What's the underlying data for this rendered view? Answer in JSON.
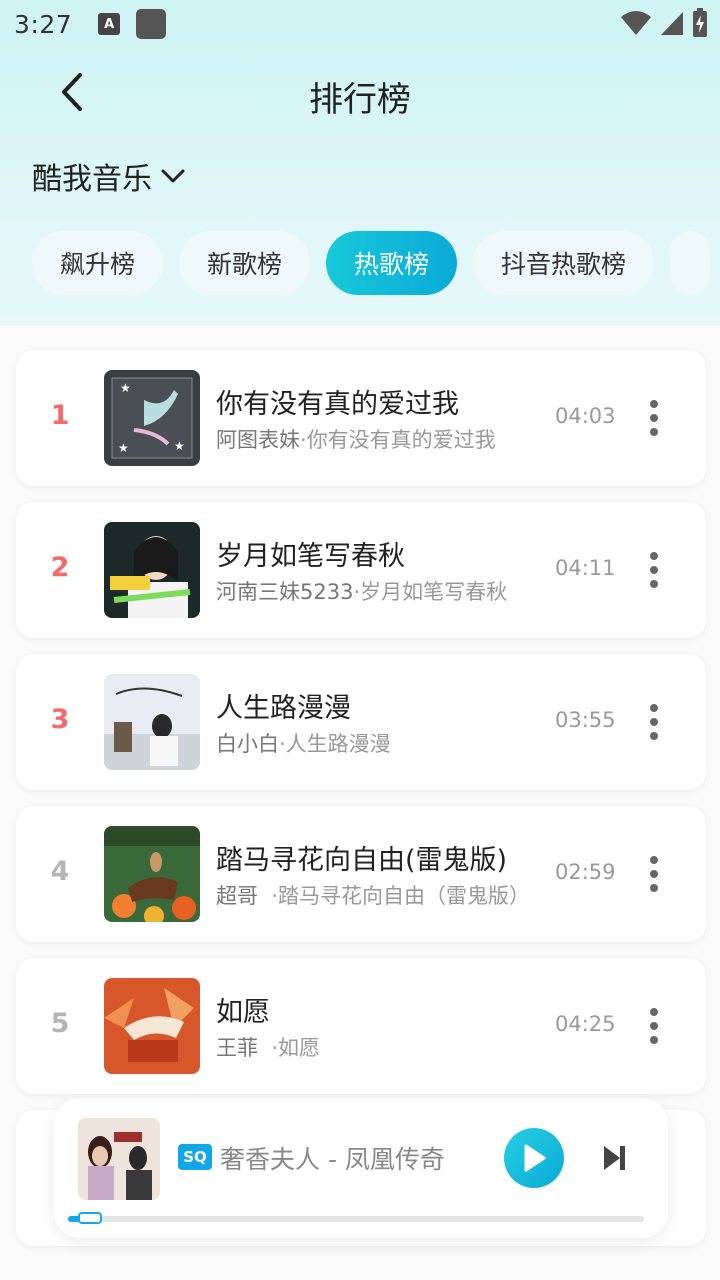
{
  "status": {
    "time": "3:27",
    "notif_icon_letter": "A"
  },
  "nav": {
    "title": "排行榜"
  },
  "source": {
    "label": "酷我音乐"
  },
  "tabs": [
    {
      "label": "飙升榜",
      "active": false
    },
    {
      "label": "新歌榜",
      "active": false
    },
    {
      "label": "热歌榜",
      "active": true
    },
    {
      "label": "抖音热歌榜",
      "active": false
    }
  ],
  "songs": [
    {
      "rank": "1",
      "title": "你有没有真的爱过我",
      "artist": "阿图表妹",
      "album": "你有没有真的爱过我",
      "duration": "04:03"
    },
    {
      "rank": "2",
      "title": "岁月如笔写春秋",
      "artist": "河南三妹5233",
      "album": "岁月如笔写春秋",
      "duration": "04:11"
    },
    {
      "rank": "3",
      "title": "人生路漫漫",
      "artist": "白小白",
      "album": "人生路漫漫",
      "duration": "03:55"
    },
    {
      "rank": "4",
      "title": "踏马寻花向自由(雷鬼版)",
      "artist": "超哥",
      "album": "踏马寻花向自由（雷鬼版）",
      "duration": "02:59"
    },
    {
      "rank": "5",
      "title": "如愿",
      "artist": "王菲",
      "album": "如愿",
      "duration": "04:25"
    }
  ],
  "player": {
    "quality_badge": "SQ",
    "now_playing": "奢香夫人 - 凤凰传奇",
    "progress": 0.02
  },
  "colors": {
    "accent": "#0aaad8",
    "rank_top": "#f36a6a",
    "rank_normal": "#b5b5b5"
  }
}
